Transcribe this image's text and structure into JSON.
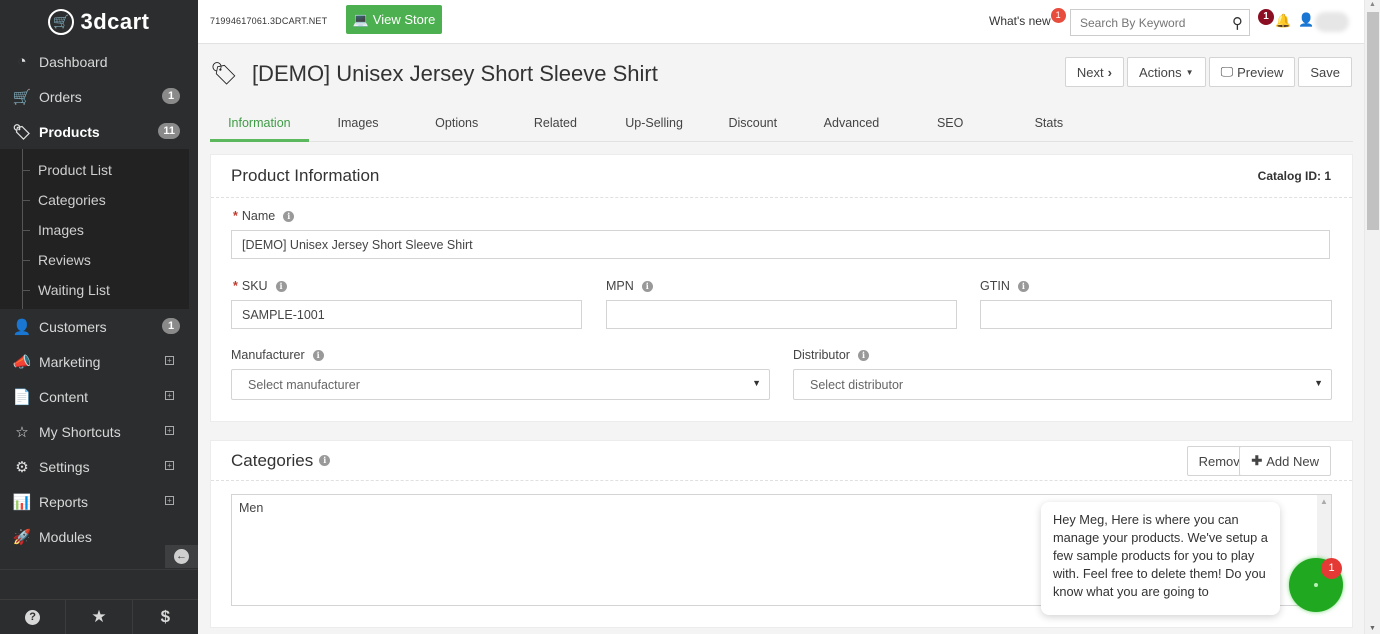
{
  "app": {
    "logo_text": "3dcart",
    "store_url": "71994617061.3DCART.NET",
    "view_store_label": "View Store",
    "whats_new_label": "What's new",
    "whats_new_count": "1",
    "search_placeholder": "Search By Keyword",
    "notification_count": "1"
  },
  "sidebar": {
    "items": [
      {
        "label": "Dashboard",
        "icon": "dashboard-icon"
      },
      {
        "label": "Orders",
        "icon": "cart-icon",
        "badge": "1"
      },
      {
        "label": "Products",
        "icon": "tags-icon",
        "badge": "11",
        "active": true
      },
      {
        "label": "Customers",
        "icon": "user-icon",
        "badge": "1"
      },
      {
        "label": "Marketing",
        "icon": "bullhorn-icon",
        "expandable": true
      },
      {
        "label": "Content",
        "icon": "file-icon",
        "expandable": true
      },
      {
        "label": "My Shortcuts",
        "icon": "star-icon",
        "expandable": true
      },
      {
        "label": "Settings",
        "icon": "cogs-icon",
        "expandable": true
      },
      {
        "label": "Reports",
        "icon": "bar-chart-icon",
        "expandable": true
      },
      {
        "label": "Modules",
        "icon": "rocket-icon"
      }
    ],
    "products_subitems": [
      "Product List",
      "Categories",
      "Images",
      "Reviews",
      "Waiting List"
    ],
    "footer_icons": [
      "help-icon",
      "star-icon",
      "dollar-icon"
    ]
  },
  "page": {
    "title": "[DEMO] Unisex Jersey Short Sleeve Shirt",
    "buttons": {
      "next": "Next",
      "actions": "Actions",
      "preview": "Preview",
      "save": "Save"
    },
    "tabs": [
      "Information",
      "Images",
      "Options",
      "Related",
      "Up-Selling",
      "Discount",
      "Advanced",
      "SEO",
      "Stats"
    ],
    "active_tab": "Information"
  },
  "product_info": {
    "title": "Product Information",
    "catalog_id": "Catalog ID: 1",
    "name_label": "Name",
    "name_value": "[DEMO] Unisex Jersey Short Sleeve Shirt",
    "sku_label": "SKU",
    "sku_value": "SAMPLE-1001",
    "mpn_label": "MPN",
    "mpn_value": "",
    "gtin_label": "GTIN",
    "gtin_value": "",
    "manufacturer_label": "Manufacturer",
    "manufacturer_placeholder": "Select manufacturer",
    "distributor_label": "Distributor",
    "distributor_placeholder": "Select distributor"
  },
  "categories": {
    "title": "Categories",
    "remove_label": "Remove",
    "add_new_label": "Add New",
    "items": [
      "Men"
    ]
  },
  "chat": {
    "message": "Hey Meg, Here is where you can manage your products. We've setup a few sample products for you to play with. Feel free to delete them! Do you know what you are going to",
    "unread_count": "1"
  },
  "colors": {
    "accent_green": "#4cb050",
    "active_tab": "#5cb85c",
    "sidebar_bg": "#2b2d2e",
    "notification_red": "#8b0e22",
    "chat_green": "#21a821"
  }
}
